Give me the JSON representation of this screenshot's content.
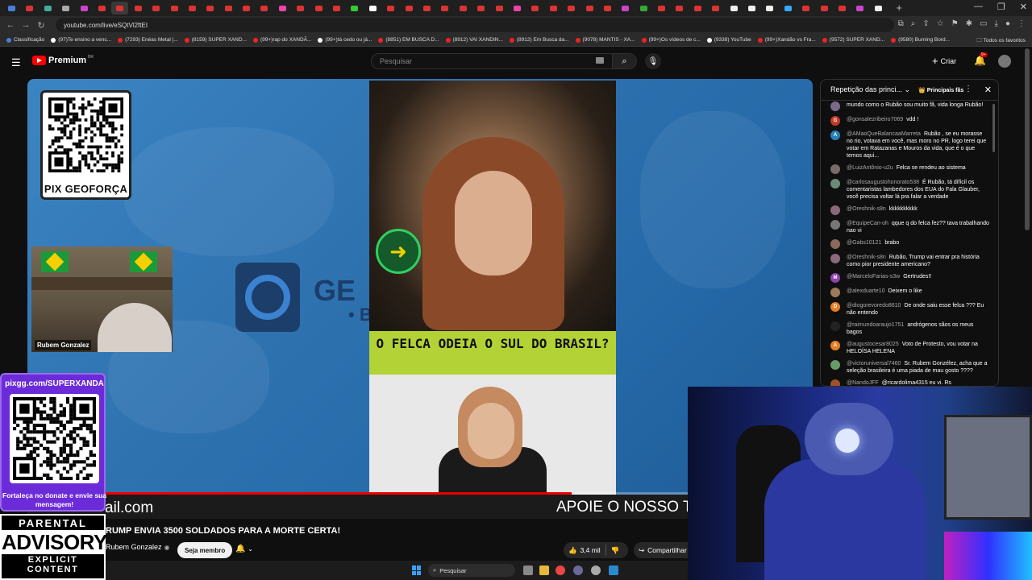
{
  "browser": {
    "tab_colors": [
      "#4a7fd6",
      "#d33",
      "#4a9",
      "#aaa",
      "#c4c",
      "#d33",
      "#d33",
      "#d33",
      "#d33",
      "#d33",
      "#d33",
      "#d33",
      "#d33",
      "#d33",
      "#d33",
      "#e4a",
      "#d33",
      "#d33",
      "#d33",
      "#3c3",
      "#fff",
      "#d33",
      "#d33",
      "#d33",
      "#d33",
      "#d33",
      "#d33",
      "#d33",
      "#e4a",
      "#d33",
      "#d33",
      "#d33",
      "#d33",
      "#d33",
      "#c4c",
      "#3a3",
      "#d33",
      "#d33",
      "#d33",
      "#d33",
      "#eee",
      "#eee",
      "#eee",
      "#3af",
      "#d33",
      "#d33",
      "#d33",
      "#c4c",
      "#eee"
    ],
    "url": "youtube.com/live/eSQtVl2ftEI",
    "bookmarks": [
      "Classificação",
      "(97)Te ensino a venc...",
      "(7293) Enéas Metal |...",
      "(8159) SUPER XAND...",
      "(99+)rap do XANDÃ...",
      "(99+)tá cedo ou já...",
      "(8851) EM BUSCA D...",
      "(8912) VAI XANDIN...",
      "(8912) Em Busca da...",
      "(9078) MANTIS - XA...",
      "(99+)Os vídeos de c...",
      "(9338) YouTube",
      "(99+)Xandão vs Fra...",
      "(9572) SUPER XAND...",
      "(9580) Burning Bord..."
    ],
    "bookmarks_right": "Todos os favoritos"
  },
  "header": {
    "logo_text": "Premium",
    "region": "BR",
    "search_placeholder": "Pesquisar",
    "create_label": "Criar",
    "notif_count": "9+"
  },
  "video": {
    "qr_label": "PIX GEOFORÇA",
    "brand_text": "GE",
    "brand_sub": "• B",
    "webcam_name": "Rubem Gonzalez",
    "banner_text": "O FELCA ODEIA O SUL DO BRASIL?",
    "ticker_left": "ail.com",
    "ticker_right": "APOIE O NOSSO T",
    "progress_fraction": 0.66
  },
  "overlay": {
    "pix_url": "pixgg.com/SUPERXANDA",
    "pix_msg": "Fortaleça no donate e envie sua mensagem!",
    "advisory_1": "PARENTAL",
    "advisory_2": "ADVISORY",
    "advisory_3": "EXPLICIT CONTENT"
  },
  "below": {
    "title": "RUMP ENVIA 3500 SOLDADOS PARA A MORTE CERTA!",
    "channel": "Rubem Gonzalez",
    "member_label": "Seja membro",
    "likes": "3,4 mil",
    "share": "Compartilhar"
  },
  "chat": {
    "title": "Repetição das princi...",
    "fan_label": "Principais fãs",
    "messages": [
      {
        "author": "",
        "text": "mundo como o Rubão sou muito fã, vida longa Rubão!",
        "color": "#7a6a8a",
        "initial": ""
      },
      {
        "author": "@gonsalezribeiro7069",
        "text": "vdd !",
        "color": "#c0392b",
        "initial": "G"
      },
      {
        "author": "@AMaoQueBalancaaMarreta",
        "text": "Rubão , se eu morasse no rio, votava em você, mas moro no PR, logo terei que votar em Ratazanas e Mouros da vida, que é o que temos aqui...",
        "color": "#2980b9",
        "initial": "A"
      },
      {
        "author": "@LuizAntônio-u2u",
        "text": "Felca se rendeu ao sistema",
        "color": "#7a6a6a",
        "initial": ""
      },
      {
        "author": "@carlosaugustohonorato538",
        "text": "É Rubão, tá difícil os comentaristas lambedores dos EUA do Fala Glauber, você precisa voltar lá pra falar a verdade",
        "color": "#6a8a7a",
        "initial": ""
      },
      {
        "author": "@Oreshnik-s8n",
        "text": "kkkkkkkkkk",
        "color": "#8a6a7a",
        "initial": ""
      },
      {
        "author": "@EquipeCan-oh",
        "text": "qque q do felca fez?? tava trabalhando nao vi",
        "color": "#777",
        "initial": ""
      },
      {
        "author": "@Gabs10121",
        "text": "brabo",
        "color": "#8a6a5a",
        "initial": ""
      },
      {
        "author": "@Oreshnik-s8n",
        "text": "Rubão, Trump vai entrar pra história como pior presidente americano?",
        "color": "#8a6a7a",
        "initial": ""
      },
      {
        "author": "@MarceloFarias-s3w",
        "text": "Gertrudes!!",
        "color": "#8e44ad",
        "initial": "M"
      },
      {
        "author": "@alexduarte10",
        "text": "Deixem o like",
        "color": "#9a7a5a",
        "initial": ""
      },
      {
        "author": "@diogorevoredo8610",
        "text": "De onde saiu esse felca ??? Eu não entendo",
        "color": "#e67e22",
        "initial": "D"
      },
      {
        "author": "@raimundoaraujo1751",
        "text": "andrógenos sãos os meus bagos",
        "color": "#222",
        "initial": ""
      },
      {
        "author": "@augustocesar8025",
        "text": "Voto de Protesto, vou votar na HELOÍSA HELENA",
        "color": "#e67e22",
        "initial": "A"
      },
      {
        "author": "@victoruniversal7460",
        "text": "Sr. Rubem Gonzélez, acha que a seleção brasileira é uma piada de mau gosto ????",
        "color": "#6a9a6a",
        "initial": ""
      },
      {
        "author": "@NandoJFF",
        "text": "@ricardolima4315 eu vi. Rs",
        "color": "#a0522d",
        "initial": ""
      }
    ]
  },
  "taskbar": {
    "search_label": "Pesquisar"
  }
}
